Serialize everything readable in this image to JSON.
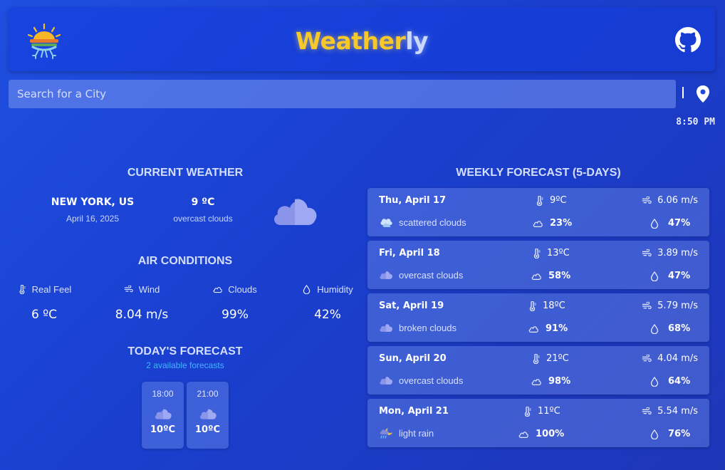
{
  "header": {
    "brand_part1": "Weather",
    "brand_part2": "ly",
    "logo_icon": "sun-frog-logo",
    "github_icon": "github-icon"
  },
  "search": {
    "placeholder": "Search for a City",
    "value": "",
    "location_icon": "location-pin-icon"
  },
  "clock": "8:50 PM",
  "current_weather": {
    "title": "CURRENT WEATHER",
    "city": "NEW YORK, US",
    "date": "April 16, 2025",
    "temp": "9 ºC",
    "description": "overcast clouds",
    "icon": "cloud-icon"
  },
  "air_conditions": {
    "title": "AIR CONDITIONS",
    "items": [
      {
        "label": "Real Feel",
        "value": "6 ºC",
        "icon": "thermometer-icon"
      },
      {
        "label": "Wind",
        "value": "8.04 m/s",
        "icon": "wind-icon"
      },
      {
        "label": "Clouds",
        "value": "99%",
        "icon": "cloud-outline-icon"
      },
      {
        "label": "Humidity",
        "value": "42%",
        "icon": "droplet-icon"
      }
    ]
  },
  "todays_forecast": {
    "title": "TODAY'S FORECAST",
    "subtitle": "2 available forecasts",
    "items": [
      {
        "time": "18:00",
        "temp": "10ºC",
        "icon": "cloud-icon"
      },
      {
        "time": "21:00",
        "temp": "10ºC",
        "icon": "cloud-icon"
      }
    ]
  },
  "weekly_forecast": {
    "title": "WEEKLY FORECAST (5-DAYS)",
    "days": [
      {
        "day": "Thu, April 17",
        "temp": "9ºC",
        "wind": "6.06 m/s",
        "desc": "scattered clouds",
        "clouds": "23%",
        "humidity": "47%",
        "icon": "scattered-clouds-icon"
      },
      {
        "day": "Fri, April 18",
        "temp": "13ºC",
        "wind": "3.89 m/s",
        "desc": "overcast clouds",
        "clouds": "58%",
        "humidity": "47%",
        "icon": "cloud-icon"
      },
      {
        "day": "Sat, April 19",
        "temp": "18ºC",
        "wind": "5.79 m/s",
        "desc": "broken clouds",
        "clouds": "91%",
        "humidity": "68%",
        "icon": "cloud-icon"
      },
      {
        "day": "Sun, April 20",
        "temp": "21ºC",
        "wind": "4.04 m/s",
        "desc": "overcast clouds",
        "clouds": "98%",
        "humidity": "64%",
        "icon": "cloud-icon"
      },
      {
        "day": "Mon, April 21",
        "temp": "11ºC",
        "wind": "5.54 m/s",
        "desc": "light rain",
        "clouds": "100%",
        "humidity": "76%",
        "icon": "night-rain-icon"
      }
    ]
  },
  "colors": {
    "background": "#1f4fe0",
    "brand_yellow": "#f7c82a",
    "accent_blue": "#3fb7ff",
    "cloud": "#8a94e8"
  }
}
